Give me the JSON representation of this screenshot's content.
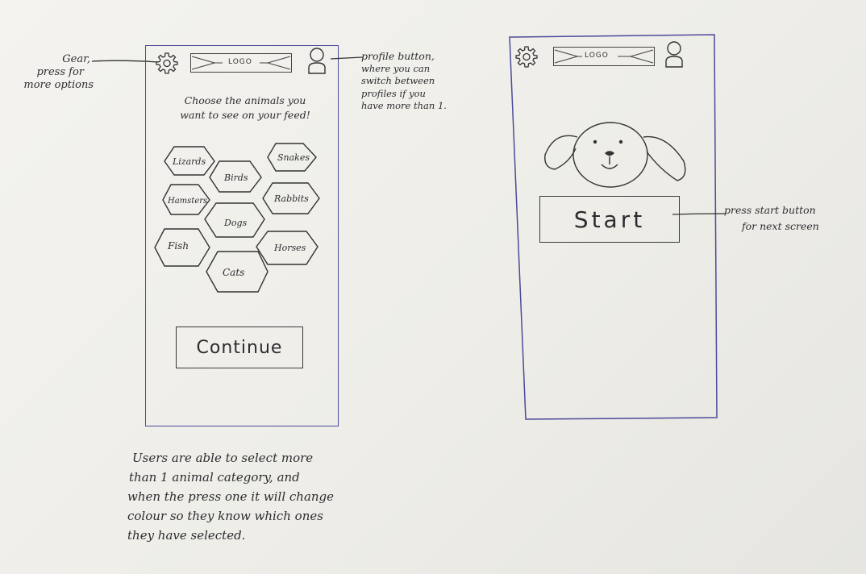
{
  "annotations": {
    "gear_note": [
      "Gear,",
      "press for",
      "more options"
    ],
    "profile_note": [
      "profile button,",
      "where you can",
      "switch between",
      "profiles if you",
      "have more than 1."
    ],
    "start_note": [
      "press start button",
      "for next screen"
    ],
    "bottom_note": [
      "Users are able to select more",
      "than 1 animal category, and",
      "when the press one it will change",
      "colour so they know which ones",
      "they have selected."
    ]
  },
  "screen1": {
    "logo": "LOGO",
    "prompt": [
      "Choose the animals you",
      "want to see on your feed!"
    ],
    "categories": [
      "Lizards",
      "Snakes",
      "Birds",
      "Hamsters",
      "Rabbits",
      "Dogs",
      "Fish",
      "Horses",
      "Cats"
    ],
    "continue_label": "Continue"
  },
  "screen2": {
    "logo": "LOGO",
    "start_label": "Start"
  },
  "icons": {
    "gear": "gear-icon",
    "profile": "profile-icon",
    "dog": "dog-face-icon"
  }
}
